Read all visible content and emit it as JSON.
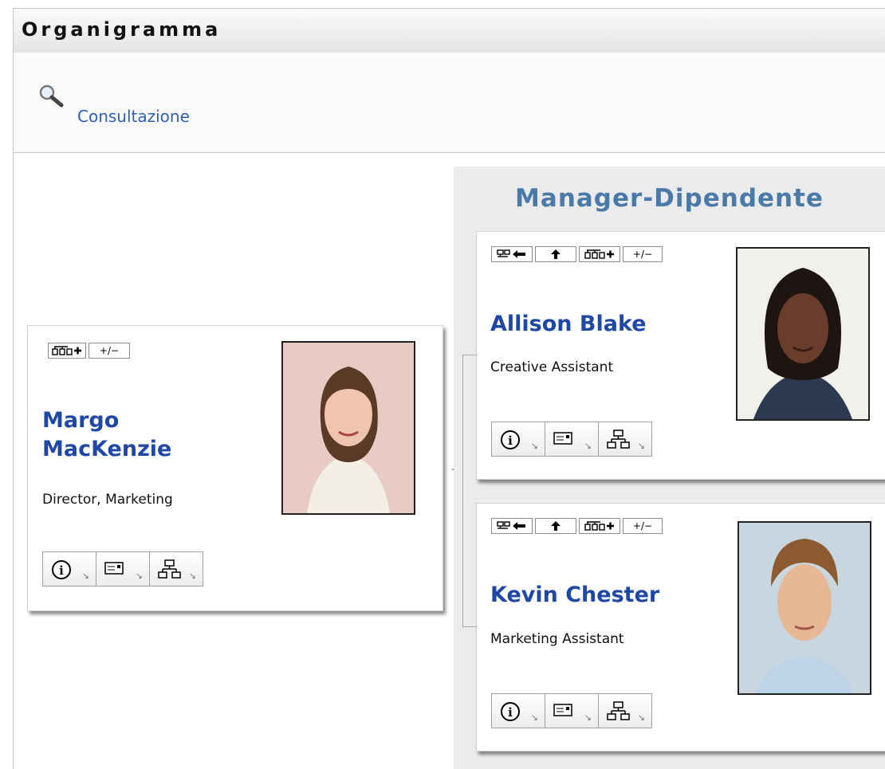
{
  "window": {
    "title": "Organigramma"
  },
  "toolbar": {
    "lookup_label": "Consultazione"
  },
  "group": {
    "title": "Manager-Dipendente"
  },
  "cards": [
    {
      "name": "Margo MacKenzie",
      "title": "Director, Marketing"
    },
    {
      "name": "Allison Blake",
      "title": "Creative Assistant"
    },
    {
      "name": "Kevin Chester",
      "title": "Marketing Assistant"
    }
  ],
  "action_labels": {
    "expand_toggle": "+/−"
  },
  "icons": {
    "search": "magnifier-icon",
    "to_manager": "manager-arrow-icon",
    "up": "up-arrow-icon",
    "add_reports": "add-reports-icon",
    "info": "info-icon",
    "email": "email-card-icon",
    "orgchart": "org-chart-icon"
  },
  "colors": {
    "name": "#1f48a6",
    "link": "#2f5fb3",
    "group_title": "#4b7aa8",
    "group_bg": "#ebebeb"
  }
}
